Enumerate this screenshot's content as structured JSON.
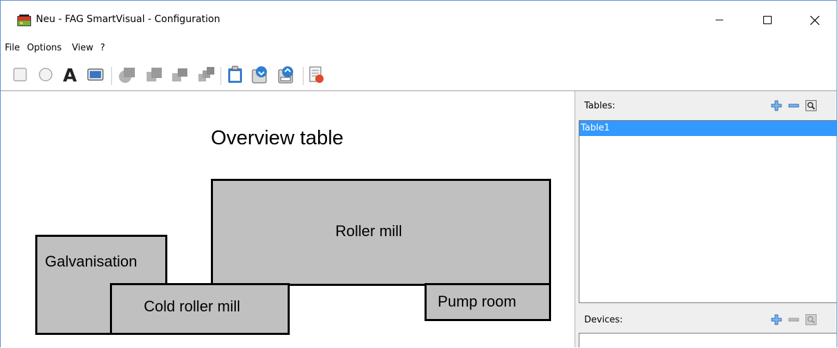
{
  "window": {
    "title": "Neu - FAG SmartVisual - Configuration",
    "controls": {
      "minimize": "—",
      "maximize": "☐",
      "close": "✕"
    }
  },
  "menu": {
    "items": [
      "File",
      "Options",
      "View",
      "?"
    ]
  },
  "toolbar": {
    "buttons": [
      "rectangle-tool",
      "ellipse-tool",
      "text-tool",
      "image-tool",
      "shape-style-1",
      "shape-style-2",
      "shape-style-3",
      "shape-style-4",
      "open",
      "import",
      "export",
      "table-settings"
    ]
  },
  "canvas": {
    "title": "Overview table",
    "zones": {
      "galvanisation": "Galvanisation",
      "cold_roller_mill": "Cold roller mill",
      "roller_mill": "Roller mill",
      "pump_room": "Pump room"
    }
  },
  "sidebar": {
    "tables_label": "Tables:",
    "tables": [
      "Table1"
    ],
    "devices_label": "Devices:"
  },
  "colors": {
    "zone_fill": "#c0c0c0",
    "selection": "#3399ff",
    "add_icon": "#2f7fd0"
  }
}
